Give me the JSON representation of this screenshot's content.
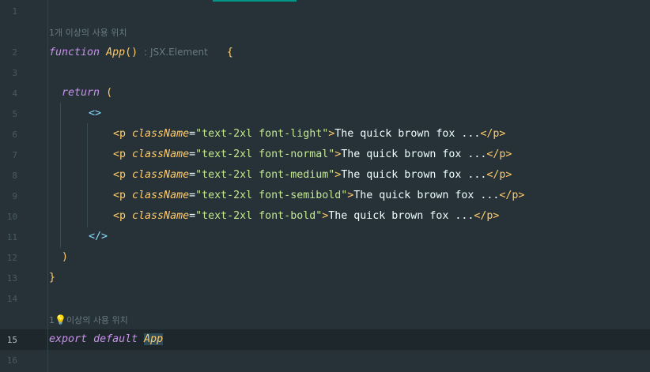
{
  "editor": {
    "line_numbers": [
      "1",
      "2",
      "3",
      "4",
      "5",
      "6",
      "7",
      "8",
      "9",
      "10",
      "11",
      "12",
      "13",
      "14",
      "15",
      "16"
    ],
    "current_line": "15",
    "hints": {
      "usage_top": "1개 이상의 사용 위치",
      "usage_bottom_prefix": "1",
      "usage_bottom_suffix": "이상의 사용 위치"
    },
    "line2": {
      "keyword": "function",
      "name": "App",
      "parens": "()",
      "type_hint": ": JSX.Element",
      "brace": "{"
    },
    "line4": {
      "keyword": "return",
      "paren": "("
    },
    "line5": {
      "fragment_open": "<>"
    },
    "p_lines": [
      {
        "open": "<p",
        "attr": "className",
        "eq": "=",
        "value": "\"text-2xl font-light\"",
        "close": ">",
        "text": "The quick brown fox ...",
        "end": "</p>"
      },
      {
        "open": "<p",
        "attr": "className",
        "eq": "=",
        "value": "\"text-2xl font-normal\"",
        "close": ">",
        "text": "The quick brown fox ...",
        "end": "</p>"
      },
      {
        "open": "<p",
        "attr": "className",
        "eq": "=",
        "value": "\"text-2xl font-medium\"",
        "close": ">",
        "text": "The quick brown fox ...",
        "end": "</p>"
      },
      {
        "open": "<p",
        "attr": "className",
        "eq": "=",
        "value": "\"text-2xl font-semibold\"",
        "close": ">",
        "text": "The quick brown fox ...",
        "end": "</p>"
      },
      {
        "open": "<p",
        "attr": "className",
        "eq": "=",
        "value": "\"text-2xl font-bold\"",
        "close": ">",
        "text": "The quick brown fox ...",
        "end": "</p>"
      }
    ],
    "line11": {
      "fragment_close": "</>"
    },
    "line12": {
      "paren": ")"
    },
    "line13": {
      "brace": "}"
    },
    "line15": {
      "kw1": "export",
      "kw2": "default",
      "name": "App"
    },
    "colors": {
      "background": "#263238",
      "keyword": "#c792ea",
      "function_name": "#ffcb6b",
      "tag": "#89ddff",
      "string": "#c3e88d",
      "text": "#eeffff"
    },
    "icons": {
      "hint_bulb": "lightbulb-icon"
    }
  }
}
